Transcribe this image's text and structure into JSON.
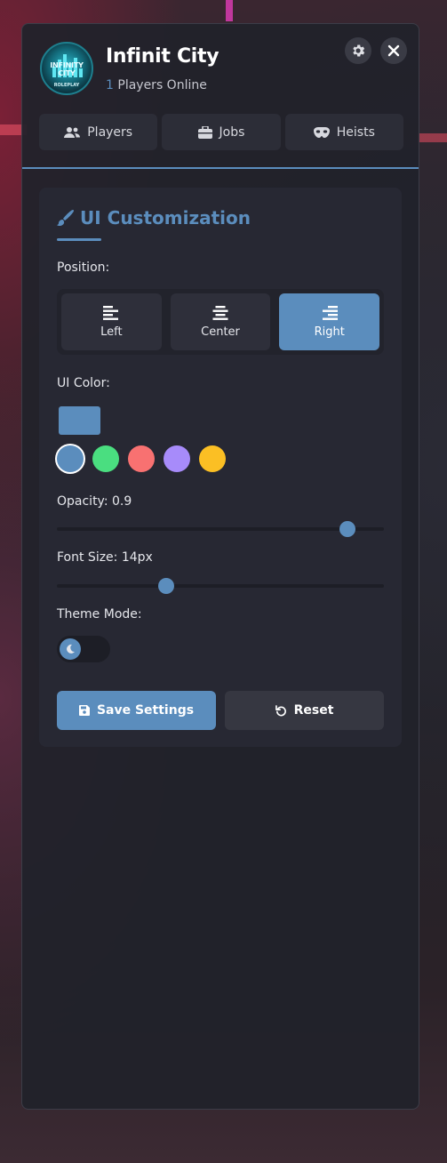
{
  "app": {
    "title": "Infinit City",
    "players_online_count": "1",
    "players_online_label": "Players Online",
    "logo_text": "INFINITY CITY",
    "logo_sub": "ROLEPLAY"
  },
  "header": {
    "settings_icon": "gear-icon",
    "close_icon": "close-icon"
  },
  "tabs": [
    {
      "label": "Players",
      "icon": "users-icon"
    },
    {
      "label": "Jobs",
      "icon": "briefcase-icon"
    },
    {
      "label": "Heists",
      "icon": "mask-icon"
    }
  ],
  "customization": {
    "title": "UI Customization",
    "position_label": "Position:",
    "positions": [
      {
        "label": "Left",
        "icon": "align-left-icon",
        "active": false
      },
      {
        "label": "Center",
        "icon": "align-center-icon",
        "active": false
      },
      {
        "label": "Right",
        "icon": "align-right-icon",
        "active": true
      }
    ],
    "color_label": "UI Color:",
    "current_color": "#5b8dbd",
    "color_options": [
      "#5b8dbd",
      "#4ade80",
      "#f87171",
      "#a78bfa",
      "#fbbf24"
    ],
    "opacity_label": "Opacity: 0.9",
    "opacity_value": 0.9,
    "font_size_label": "Font Size: 14px",
    "font_size_value": 14,
    "theme_label": "Theme Mode:",
    "theme_mode": "dark",
    "save_label": "Save Settings",
    "reset_label": "Reset"
  },
  "colors": {
    "accent": "#5b8dbd",
    "panel": "#21222b",
    "card": "#272833"
  }
}
